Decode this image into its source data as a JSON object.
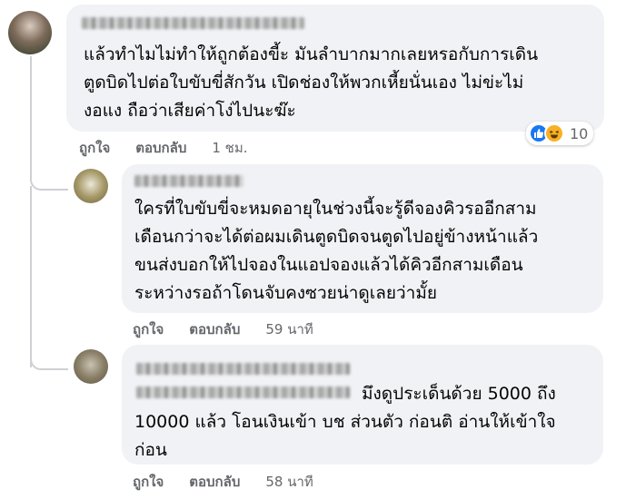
{
  "comments": [
    {
      "text": "แล้วทำไมไม่ทำให้ถูกต้องขี้ะ มันลำบากมากเลยหรอกับการเดิน\nตูดบิดไปต่อใบขับขี่สักวัน เปิดช่องให้พวกเหี้ยนั่นเอง ไม่ข่ะไม่\nงอแง ถือว่าเสียค่าโง่ไปนะฆ๊ะ",
      "like_label": "ถูกใจ",
      "reply_label": "ตอบกลับ",
      "time": "1 ชม.",
      "reaction_count": "10"
    },
    {
      "text": "ใครที่ใบขับขี่จะหมดอายุในช่วงนี้จะรู้ดีจองคิวรออีกสาม\nเดือนกว่าจะได้ต่อผมเดินตูดบิดจนตูดไปอยู่ข้างหน้าแล้ว\nขนส่งบอกให้ไปจองในแอปจองแล้วได้คิวอีกสามเดือน\nระหว่างรอถ้าโดนจับคงซวยน่าดูเลยว่ามั้ย",
      "like_label": "ถูกใจ",
      "reply_label": "ตอบกลับ",
      "time": "59 นาที"
    },
    {
      "text_line1": "มึงดูประเด็นด้วย 5000 ถึง",
      "text_rest": "10000 แล้ว โอนเงินเข้า บช ส่วนตัว ก่อนติ อ่านให้เข้าใจ\nก่อน",
      "like_label": "ถูกใจ",
      "reply_label": "ตอบกลับ",
      "time": "58 นาที"
    }
  ],
  "icons": {
    "like": "like-icon",
    "haha": "haha-icon"
  }
}
